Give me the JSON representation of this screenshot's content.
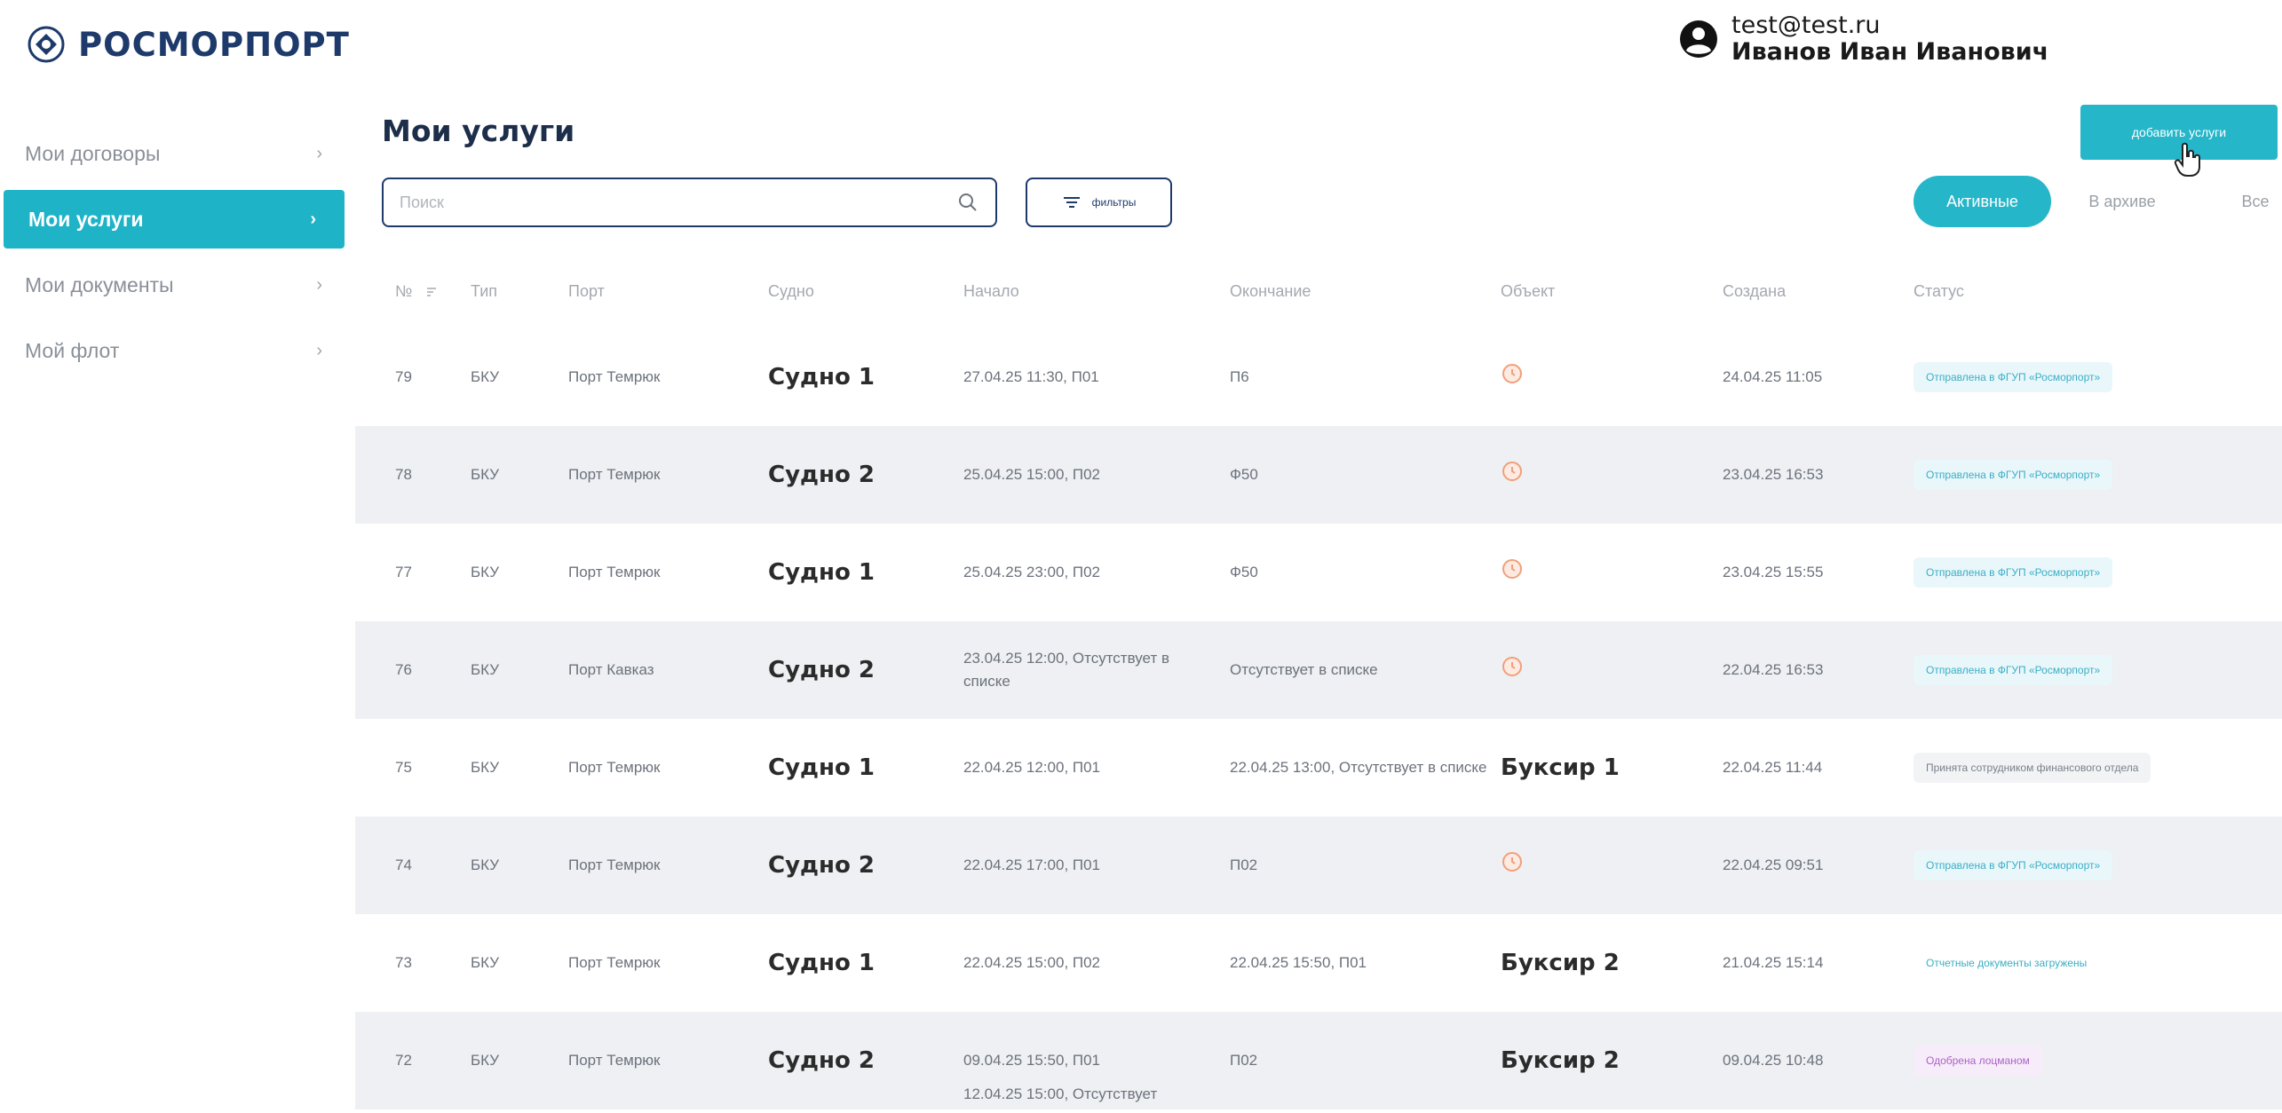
{
  "brand": {
    "name": "РОСМОРПОРТ",
    "logo_icon": "emblem-icon"
  },
  "user": {
    "email": "test@test.ru",
    "name": "Иванов Иван Иванович",
    "icon": "user-circle-icon"
  },
  "sidebar": {
    "items": [
      {
        "label": "Мои договоры",
        "active": false
      },
      {
        "label": "Мои услуги",
        "active": true
      },
      {
        "label": "Мои документы",
        "active": false
      },
      {
        "label": "Мой флот",
        "active": false
      }
    ]
  },
  "main": {
    "title": "Мои услуги",
    "add_button": "добавить услуги",
    "search_placeholder": "Поиск",
    "filters_label": "фильтры",
    "tabs": {
      "active": "Активные",
      "archive": "В архиве",
      "all": "Все"
    }
  },
  "table": {
    "headers": {
      "num": "№",
      "type": "Тип",
      "port": "Порт",
      "vessel": "Судно",
      "start": "Начало",
      "end": "Окончание",
      "object": "Объект",
      "created": "Создана",
      "status": "Статус"
    },
    "rows": [
      {
        "num": "79",
        "type": "БКУ",
        "port": "Порт Темрюк",
        "vessel": "Судно 1",
        "start": "27.04.25 11:30, П01",
        "end": "П6",
        "object": "",
        "created": "24.04.25 11:05",
        "status": "Отправлена в ФГУП «Росморпорт»"
      },
      {
        "num": "78",
        "type": "БКУ",
        "port": "Порт Темрюк",
        "vessel": "Судно 2",
        "start": "25.04.25 15:00, П02",
        "end": "Ф50",
        "object": "",
        "created": "23.04.25 16:53",
        "status": "Отправлена в ФГУП «Росморпорт»"
      },
      {
        "num": "77",
        "type": "БКУ",
        "port": "Порт Темрюк",
        "vessel": "Судно 1",
        "start": "25.04.25 23:00, П02",
        "end": "Ф50",
        "object": "",
        "created": "23.04.25 15:55",
        "status": "Отправлена в ФГУП «Росморпорт»"
      },
      {
        "num": "76",
        "type": "БКУ",
        "port": "Порт Кавказ",
        "vessel": "Судно 2",
        "start": "23.04.25 12:00, Отсутствует в списке",
        "end": "Отсутствует в списке",
        "object": "",
        "created": "22.04.25 16:53",
        "status": "Отправлена в ФГУП «Росморпорт»"
      },
      {
        "num": "75",
        "type": "БКУ",
        "port": "Порт Темрюк",
        "vessel": "Судно 1",
        "start": "22.04.25 12:00, П01",
        "end": "22.04.25 13:00, Отсутствует в списке",
        "object": "Буксир 1",
        "created": "22.04.25 11:44",
        "status": "Принята сотрудником финансового отдела"
      },
      {
        "num": "74",
        "type": "БКУ",
        "port": "Порт Темрюк",
        "vessel": "Судно 2",
        "start": "22.04.25 17:00, П01",
        "end": "П02",
        "object": "",
        "created": "22.04.25 09:51",
        "status": "Отправлена в ФГУП «Росморпорт»"
      },
      {
        "num": "73",
        "type": "БКУ",
        "port": "Порт Темрюк",
        "vessel": "Судно 1",
        "start": "22.04.25 15:00, П02",
        "end": "22.04.25 15:50, П01",
        "object": "Буксир 2",
        "created": "21.04.25 15:14",
        "status": "Отчетные документы загружены"
      },
      {
        "num": "72",
        "type": "БКУ",
        "port": "Порт Темрюк",
        "vessel": "Судно 2",
        "start": "09.04.25 15:50, П01",
        "end": "П02",
        "object": "Буксир 2",
        "created": "09.04.25 10:48",
        "status": "Одобрена лоцманом"
      }
    ],
    "partial_row": {
      "start": "12.04.25 15:00, Отсутствует"
    }
  },
  "colors": {
    "accent": "#25b6c9",
    "brand": "#1d3a6b",
    "pending_clock": "#f0a07a",
    "approved": "#b061c9"
  }
}
